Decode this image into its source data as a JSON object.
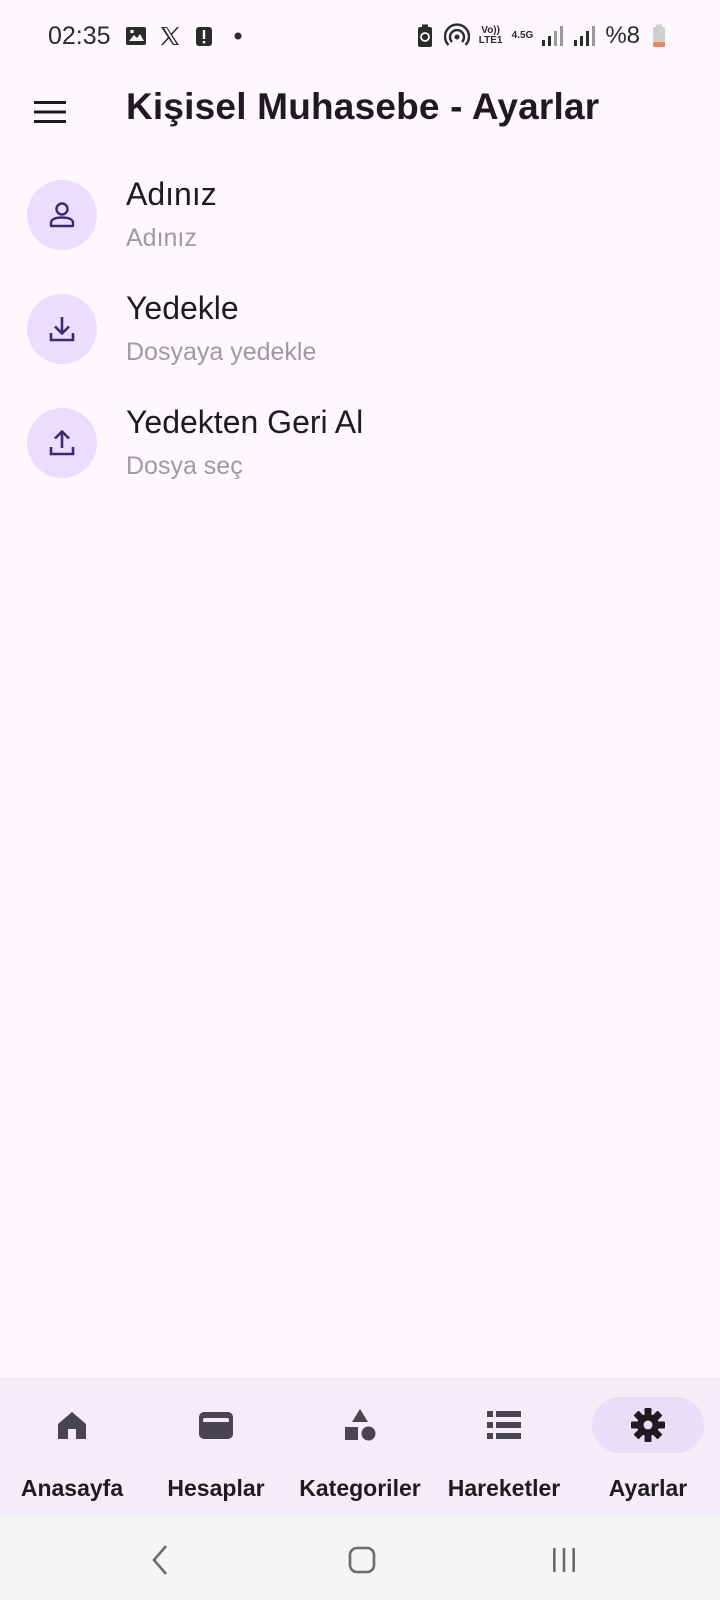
{
  "status_bar": {
    "time": "02:35",
    "left_icons": [
      "image-icon",
      "x-logo-icon",
      "alert-icon",
      "dot-icon"
    ],
    "network_top": "Vo)) LTE1",
    "network_type": "4.5G",
    "battery": "%8"
  },
  "app_bar": {
    "title": "Kişisel Muhasebe - Ayarlar",
    "menu_icon": "menu-icon"
  },
  "settings": {
    "items": [
      {
        "title": "Adınız",
        "subtitle": "Adınız",
        "icon": "person-icon"
      },
      {
        "title": "Yedekle",
        "subtitle": "Dosyaya yedekle",
        "icon": "download-icon"
      },
      {
        "title": "Yedekten Geri Al",
        "subtitle": "Dosya seç",
        "icon": "upload-icon"
      }
    ]
  },
  "bottom_nav": {
    "items": [
      {
        "label": "Anasayfa",
        "icon": "home-icon",
        "active": false
      },
      {
        "label": "Hesaplar",
        "icon": "wallet-icon",
        "active": false
      },
      {
        "label": "Kategoriler",
        "icon": "category-icon",
        "active": false
      },
      {
        "label": "Hareketler",
        "icon": "list-icon",
        "active": false
      },
      {
        "label": "Ayarlar",
        "icon": "gear-icon",
        "active": true
      }
    ]
  },
  "colors": {
    "background": "#fdf7fe",
    "avatar_bg": "#eaddff",
    "nav_bg": "#f3edf7",
    "nav_indicator": "#e8def8",
    "icon_primary": "#4f378b",
    "subtitle": "#9e9aa3"
  }
}
